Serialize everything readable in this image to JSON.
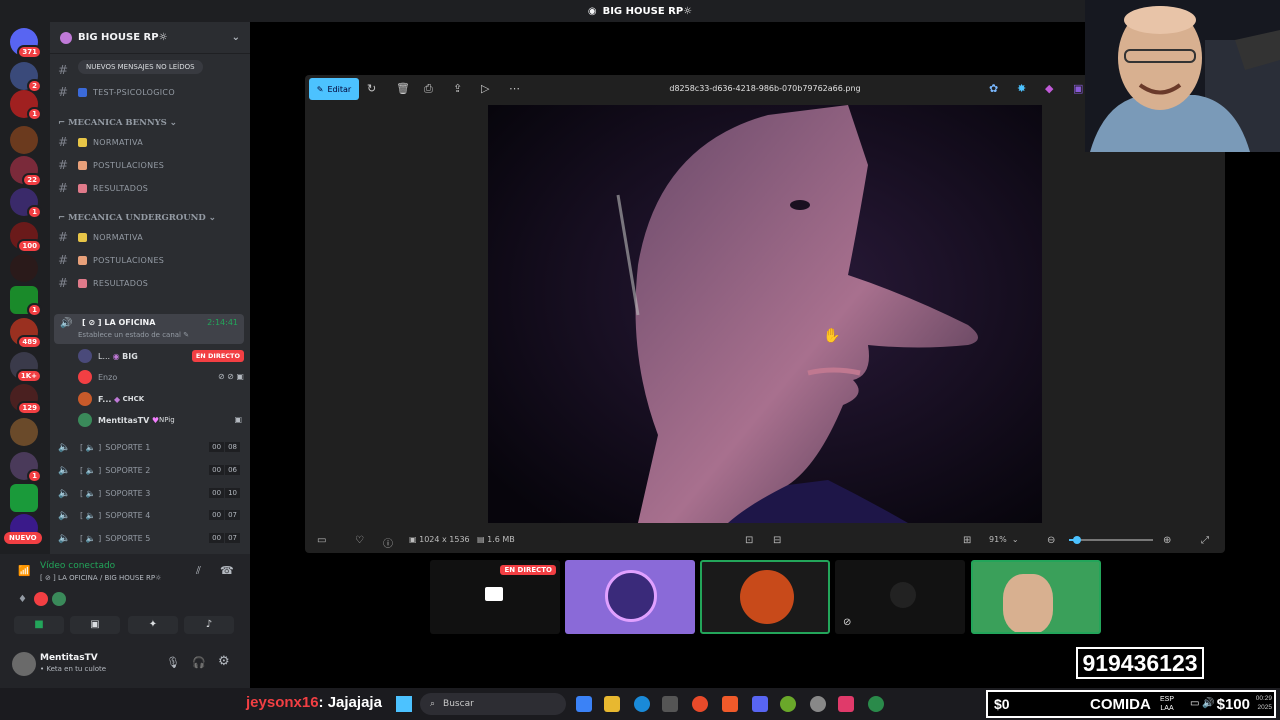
{
  "titlebar": {
    "title": "BIG HOUSE RP☼"
  },
  "rail": {
    "badges": [
      "371",
      "2",
      "1",
      "22",
      "1",
      "100",
      "1",
      "489",
      "1K+",
      "129",
      "1"
    ],
    "nuevo": "NUEVO"
  },
  "sidebar": {
    "server_name": "BIG HOUSE RP☼",
    "unread_pill": "NUEVOS MENSAJES NO LEÍDOS",
    "channels_top": [
      {
        "label": "TEST-PSICOLOGICO"
      }
    ],
    "categories": [
      {
        "label": "MECANICA BENNYS",
        "channels": [
          "NORMATIVA",
          "POSTULACIONES",
          "RESULTADOS"
        ]
      },
      {
        "label": "MECANICA UNDERGROUND",
        "channels": [
          "NORMATIVA",
          "POSTULACIONES",
          "RESULTADOS"
        ]
      }
    ],
    "voice_channel": {
      "name": "LA OFICINA",
      "timer": "2:14:41",
      "status_hint": "Establece un estado de canal",
      "users": [
        {
          "name": "L...",
          "tag": "BIG",
          "live": "EN DIRECTO"
        },
        {
          "name": "Enzo"
        },
        {
          "name": "F...",
          "tag": "CHCK"
        },
        {
          "name": "MentitasTV",
          "tag": "NPig"
        }
      ]
    },
    "soporte": [
      {
        "name": "SOPORTE 1",
        "a": "00",
        "b": "08"
      },
      {
        "name": "SOPORTE 2",
        "a": "00",
        "b": "06"
      },
      {
        "name": "SOPORTE 3",
        "a": "00",
        "b": "10"
      },
      {
        "name": "SOPORTE 4",
        "a": "00",
        "b": "07"
      },
      {
        "name": "SOPORTE 5",
        "a": "00",
        "b": "07"
      }
    ]
  },
  "voice_panel": {
    "status": "Vídeo conectado",
    "location": "LA OFICINA / BIG HOUSE RP☼"
  },
  "user_panel": {
    "username": "MentitasTV",
    "custom_status": "Keta en tu culote"
  },
  "viewer": {
    "edit_label": "Editar",
    "filename": "d8258c33-d636-4218-986b-070b79762a66.png",
    "dimensions": "1024 x 1536",
    "size": "1.6 MB",
    "zoom": "91%",
    "zoom_slider_fraction": 0.1
  },
  "streams": {
    "live_label": "EN DIRECTO"
  },
  "overlay": {
    "phone": "919436123"
  },
  "taskbar": {
    "chat_user": "jeysonx16",
    "chat_msg": ": Jajajaja",
    "search_placeholder": "Buscar",
    "lang": "ESP",
    "lang2": "LAA",
    "time": "00:29",
    "date": "2025"
  },
  "donation_bar": {
    "left": "$0",
    "label": "COMIDA",
    "right": "$100"
  },
  "colors": {
    "discord_bg": "#2b2d31",
    "rail_bg": "#1e1f22",
    "live_red": "#f23f43",
    "accent_blue": "#4cc2ff",
    "connected_green": "#23a55a"
  }
}
